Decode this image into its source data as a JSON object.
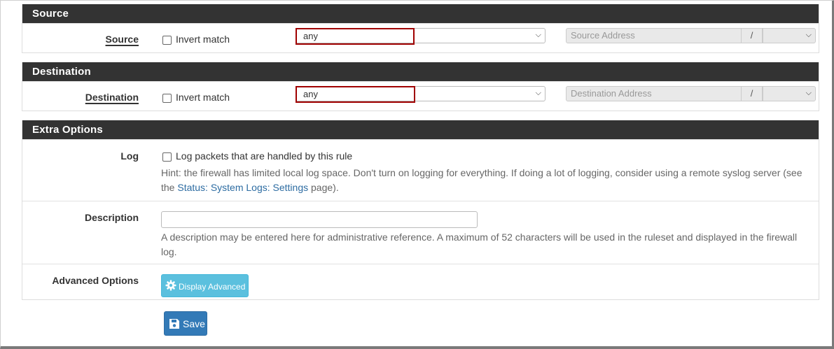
{
  "source": {
    "heading": "Source",
    "label": "Source",
    "invert_label": "Invert match",
    "type_value": "any",
    "address_placeholder": "Source Address",
    "slash": "/"
  },
  "destination": {
    "heading": "Destination",
    "label": "Destination",
    "invert_label": "Invert match",
    "type_value": "any",
    "address_placeholder": "Destination Address",
    "slash": "/"
  },
  "extra": {
    "heading": "Extra Options",
    "log": {
      "label": "Log",
      "checkbox_label": "Log packets that are handled by this rule",
      "hint_before": "Hint: the firewall has limited local log space. Don't turn on logging for everything. If doing a lot of logging, consider using a remote syslog server (see the ",
      "hint_link": "Status: System Logs: Settings",
      "hint_after": " page)."
    },
    "description": {
      "label": "Description",
      "value": "",
      "hint": "A description may be entered here for administrative reference. A maximum of 52 characters will be used in the ruleset and displayed in the firewall log."
    },
    "advanced": {
      "label": "Advanced Options",
      "button_label": "Display Advanced"
    }
  },
  "save_label": "Save",
  "icons": [
    "gear-icon",
    "save-icon",
    "chevron-down-icon"
  ],
  "colors": {
    "heading_bg": "#333333",
    "highlight_border": "#a00000",
    "info_button": "#5bc0de",
    "primary_button": "#337ab7",
    "link": "#2d6ca2"
  }
}
